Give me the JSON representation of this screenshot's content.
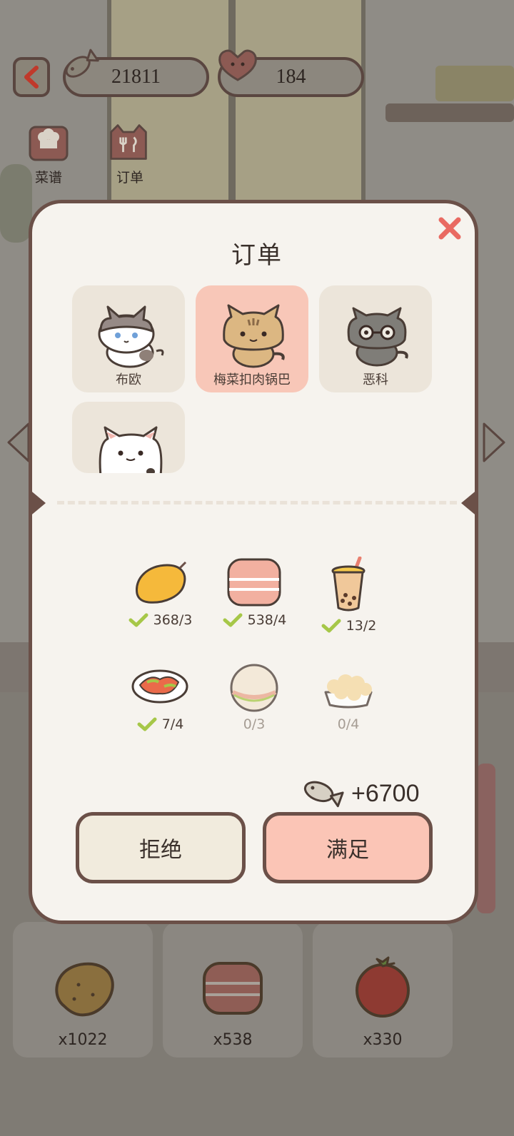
{
  "topbar": {
    "fish_count": "21811",
    "heart_count": "184"
  },
  "tabs": [
    {
      "label": "菜谱"
    },
    {
      "label": "订单"
    }
  ],
  "modal": {
    "title": "订单",
    "cats": [
      {
        "name": "布欧"
      },
      {
        "name": "梅菜扣肉锅巴"
      },
      {
        "name": "恶科"
      },
      {
        "name": ""
      }
    ],
    "ingredients": [
      {
        "icon": "mango-icon",
        "count": "368/3",
        "fulfilled": true
      },
      {
        "icon": "bacon-stack-icon",
        "count": "538/4",
        "fulfilled": true
      },
      {
        "icon": "bubble-tea-icon",
        "count": "13/2",
        "fulfilled": true
      },
      {
        "icon": "tomato-dish-icon",
        "count": "7/4",
        "fulfilled": true
      },
      {
        "icon": "sandwich-icon",
        "count": "0/3",
        "fulfilled": false
      },
      {
        "icon": "popcorn-chicken-icon",
        "count": "0/4",
        "fulfilled": false
      }
    ],
    "reward": "+6700",
    "reject_label": "拒绝",
    "accept_label": "满足"
  },
  "inventory": [
    {
      "icon": "potato-icon",
      "count": "x1022"
    },
    {
      "icon": "bacon-icon",
      "count": "x538"
    },
    {
      "icon": "tomato-icon",
      "count": "x330"
    }
  ],
  "colors": {
    "accent": "#fbc5b6",
    "border": "#6b5048",
    "check": "#a6c748",
    "close": "#e96a62"
  }
}
